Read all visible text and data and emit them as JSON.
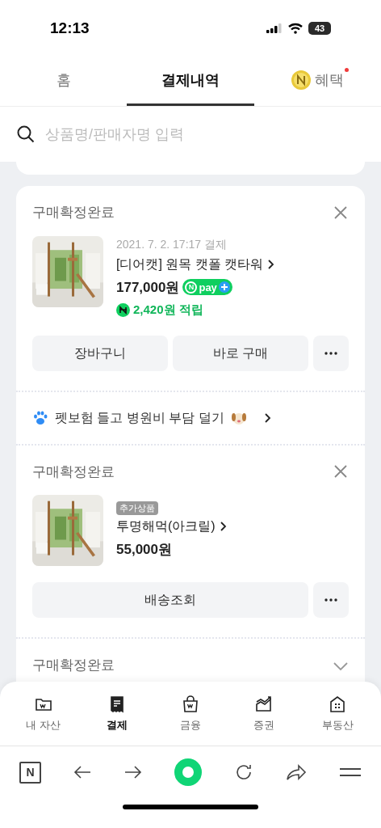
{
  "status_bar": {
    "time": "12:13",
    "battery": "43"
  },
  "tabs": [
    {
      "label": "홈",
      "selected": false,
      "kind": "plain"
    },
    {
      "label": "결제내역",
      "selected": true,
      "kind": "plain"
    },
    {
      "label": "혜택",
      "selected": false,
      "kind": "coin",
      "badge": true
    }
  ],
  "search": {
    "placeholder": "상품명/판매자명 입력"
  },
  "orders": [
    {
      "status": "구매확정완료",
      "date": "2021. 7. 2. 17:17 결제",
      "name": "[디어캣] 원목 캣폴 캣타워",
      "price": "177,000원",
      "npay": {
        "mark": "N",
        "text": "pay"
      },
      "points": "2,420원 적립",
      "buttons": [
        "장바구니",
        "바로 구매"
      ],
      "promo": "펫보험 들고 병원비 부담 덜기"
    },
    {
      "status": "구매확정완료",
      "tag": "추가상품",
      "name": "투명해먹(아크릴)",
      "price": "55,000원",
      "buttons": [
        "배송조회"
      ]
    }
  ],
  "collapsed_order": {
    "status": "구매확정완료"
  },
  "bottom_nav": [
    {
      "label": "내 자산",
      "selected": false,
      "kind": "wallet"
    },
    {
      "label": "결제",
      "selected": true,
      "kind": "receipt"
    },
    {
      "label": "금융",
      "selected": false,
      "kind": "bag"
    },
    {
      "label": "증권",
      "selected": false,
      "kind": "chart"
    },
    {
      "label": "부동산",
      "selected": false,
      "kind": "building"
    }
  ],
  "browser_bar": {
    "home_letter": "N"
  }
}
